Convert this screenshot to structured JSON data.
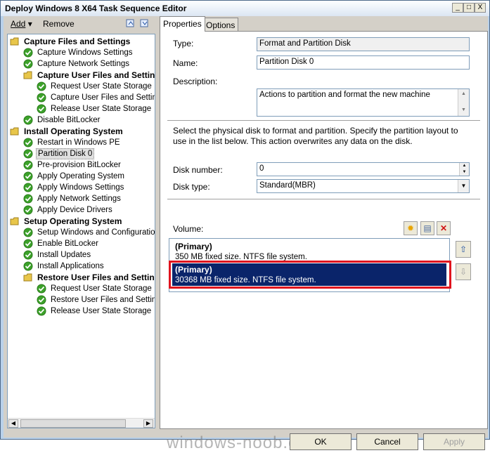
{
  "window": {
    "title": "Deploy Windows 8 X64 Task Sequence Editor",
    "minimize": "_",
    "maximize": "□",
    "close": "X"
  },
  "toolbar": {
    "add": "Add",
    "remove": "Remove"
  },
  "tree": [
    {
      "label": "Capture Files and Settings",
      "group": true,
      "depth": 0
    },
    {
      "label": "Capture Windows Settings",
      "depth": 1
    },
    {
      "label": "Capture Network Settings",
      "depth": 1
    },
    {
      "label": "Capture User Files and Settings",
      "group": true,
      "depth": 1
    },
    {
      "label": "Request User State Storage",
      "depth": 2
    },
    {
      "label": "Capture User Files and Settings",
      "depth": 2
    },
    {
      "label": "Release User State Storage",
      "depth": 2
    },
    {
      "label": "Disable BitLocker",
      "depth": 1
    },
    {
      "label": "Install Operating System",
      "group": true,
      "depth": 0
    },
    {
      "label": "Restart in Windows PE",
      "depth": 1
    },
    {
      "label": "Partition Disk 0",
      "depth": 1,
      "selected": true
    },
    {
      "label": "Pre-provision BitLocker",
      "depth": 1
    },
    {
      "label": "Apply Operating System",
      "depth": 1
    },
    {
      "label": "Apply Windows Settings",
      "depth": 1
    },
    {
      "label": "Apply Network Settings",
      "depth": 1
    },
    {
      "label": "Apply Device Drivers",
      "depth": 1
    },
    {
      "label": "Setup Operating System",
      "group": true,
      "depth": 0
    },
    {
      "label": "Setup Windows and Configuration",
      "depth": 1
    },
    {
      "label": "Enable BitLocker",
      "depth": 1
    },
    {
      "label": "Install Updates",
      "depth": 1
    },
    {
      "label": "Install Applications",
      "depth": 1
    },
    {
      "label": "Restore User Files and Settings",
      "group": true,
      "depth": 1
    },
    {
      "label": "Request User State Storage",
      "depth": 2
    },
    {
      "label": "Restore User Files and Settings",
      "depth": 2
    },
    {
      "label": "Release User State Storage",
      "depth": 2
    }
  ],
  "tabs": {
    "properties": "Properties",
    "options": "Options"
  },
  "props": {
    "type_label": "Type:",
    "type_value": "Format and Partition Disk",
    "name_label": "Name:",
    "name_value": "Partition Disk 0",
    "desc_label": "Description:",
    "desc_value": "Actions to partition and format the new machine",
    "info": "Select the physical disk to format and partition. Specify the partition layout to use in the list below. This action overwrites any data on the disk.",
    "disk_number_label": "Disk number:",
    "disk_number_value": "0",
    "disk_type_label": "Disk type:",
    "disk_type_value": "Standard(MBR)",
    "volume_label": "Volume:"
  },
  "volumes": [
    {
      "title": "(Primary)",
      "detail": "350 MB fixed size. NTFS file system."
    },
    {
      "title": "(Primary)",
      "detail": "30368 MB fixed size. NTFS file system.",
      "selected": true
    }
  ],
  "buttons": {
    "ok": "OK",
    "cancel": "Cancel",
    "apply": "Apply"
  },
  "watermark": "windows-noob.com",
  "colors": {
    "selection": "#0a246a",
    "highlight_frame": "#e0141e",
    "check": "#3ca22a",
    "folder": "#e8c64a"
  }
}
